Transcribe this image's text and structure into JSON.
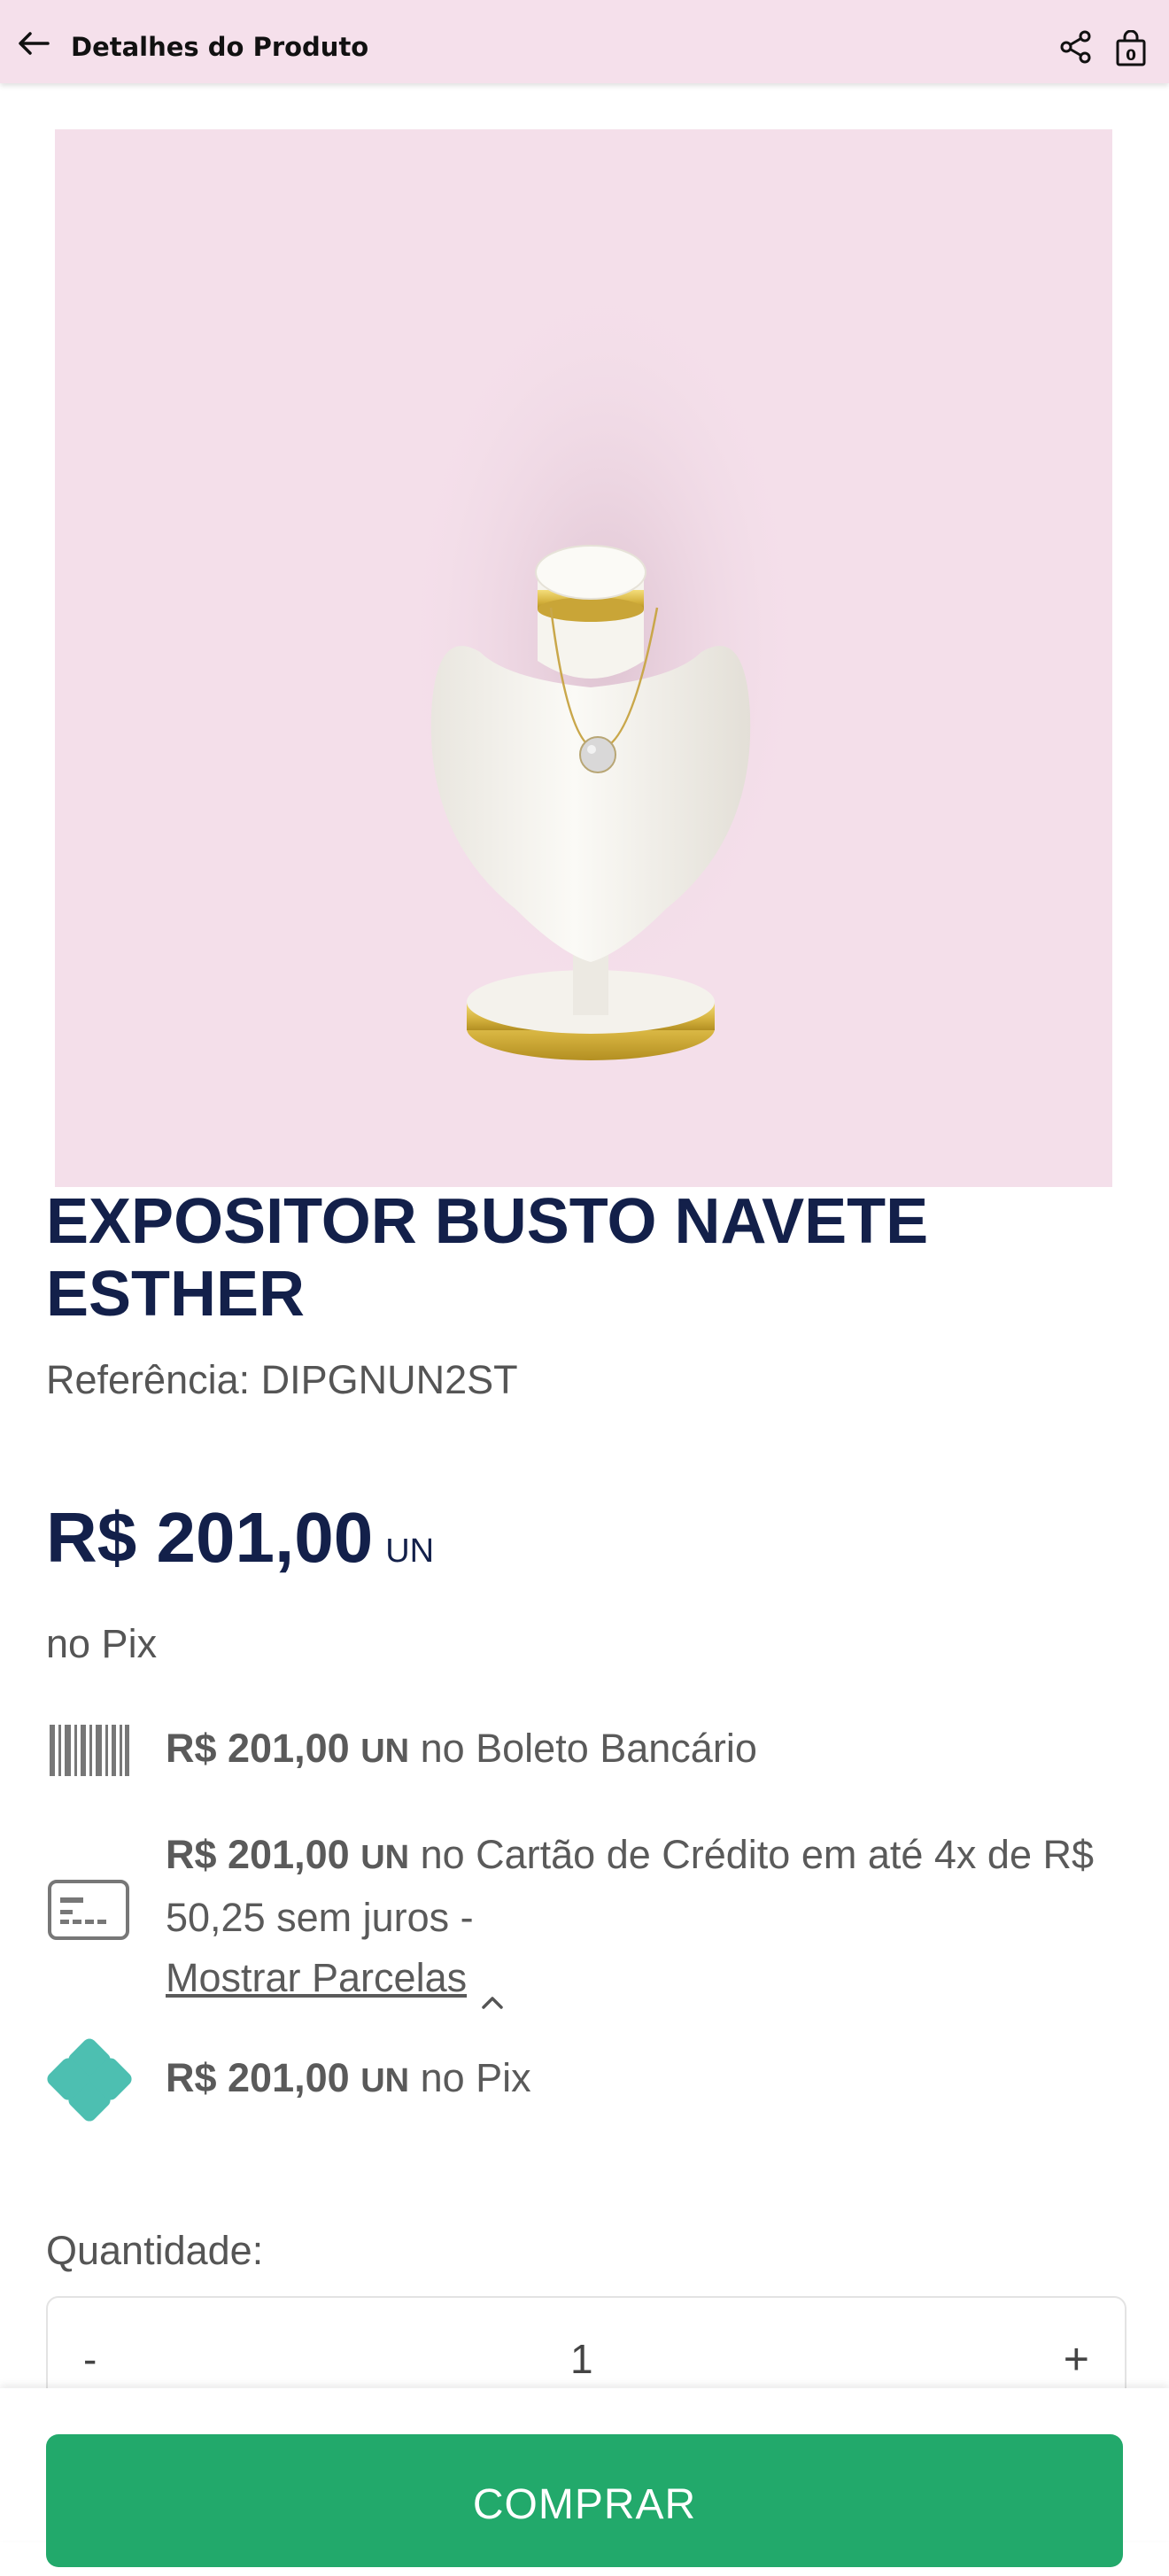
{
  "header": {
    "title": "Detalhes do Produto"
  },
  "product": {
    "title": "EXPOSITOR BUSTO NAVETE ESTHER",
    "reference": "Referência: DIPGNUN2ST",
    "price": "R$ 201,00",
    "unit": "UN",
    "price_note": "no Pix"
  },
  "payments": {
    "boleto": {
      "price": "R$ 201,00",
      "unit": "UN",
      "text": " no Boleto Bancário"
    },
    "card": {
      "price": "R$ 201,00",
      "unit": "UN",
      "text": " no Cartão de Crédito em até 4x de R$ 50,25 sem juros -",
      "link": "Mostrar Parcelas"
    },
    "pix": {
      "price": "R$ 201,00",
      "unit": "UN",
      "text": " no Pix"
    }
  },
  "quantity": {
    "label": "Quantidade:",
    "minus": "-",
    "value": "1",
    "plus": "+"
  },
  "buy_button": "COMPRAR",
  "colors": {
    "header_bg": "#f5e0eb",
    "title": "#13204a",
    "buy": "#22a96b",
    "pix": "#4dbfb1"
  }
}
